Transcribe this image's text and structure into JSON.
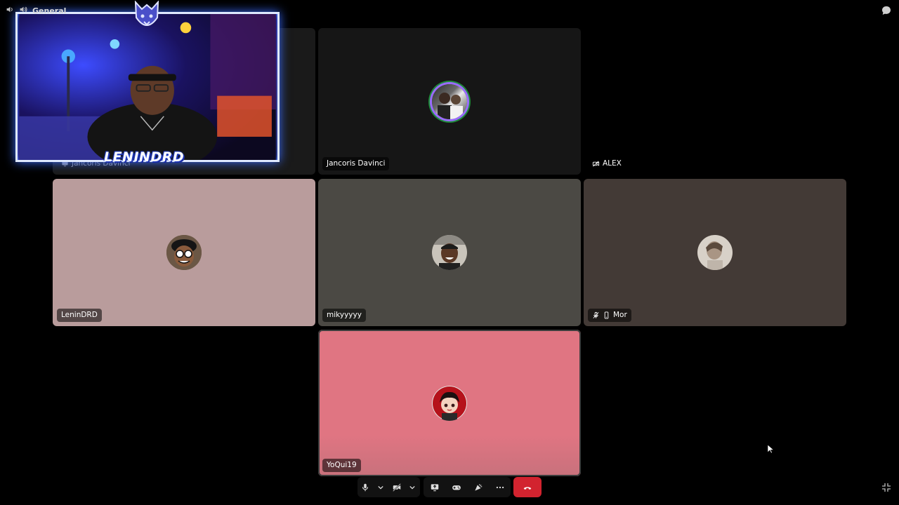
{
  "channel": {
    "name": "General",
    "speaker_icon": "speaker-icon",
    "voice_icon": "voice-channel-icon"
  },
  "colors": {
    "background": "#000000",
    "tile_dark": "#161616",
    "tile_rose": "#b99c9c",
    "tile_olive": "#4b4944",
    "tile_brown": "#433a36",
    "tile_pink": "#e07582",
    "end_call": "#d2232f",
    "speaking_ring": "#9b6bff"
  },
  "participants": [
    {
      "name": "Jancoris Davinci",
      "tile": "stream",
      "icon": "screen-share-icon"
    },
    {
      "name": "Jancoris Davinci",
      "tile": "avatar",
      "speaking": true
    },
    {
      "name": "ALEX",
      "tile": "audio-only",
      "icon": "video-off-icon"
    },
    {
      "name": "LeninDRD",
      "tile": "avatar"
    },
    {
      "name": "mikyyyyy",
      "tile": "avatar"
    },
    {
      "name": "Mor",
      "tile": "avatar",
      "icons": [
        "muted-mic-icon",
        "mobile-icon"
      ]
    },
    {
      "name": "YoQui19",
      "tile": "avatar",
      "active": true
    }
  ],
  "stream_overlay": {
    "logo_text": "LENINDRD",
    "badge_icon": "wolf-logo-icon"
  },
  "toolbar": {
    "buttons": [
      "microphone-icon",
      "camera-off-icon",
      "screen-share-icon",
      "activities-icon",
      "soundboard-icon",
      "more-options-icon",
      "disconnect-icon"
    ]
  }
}
